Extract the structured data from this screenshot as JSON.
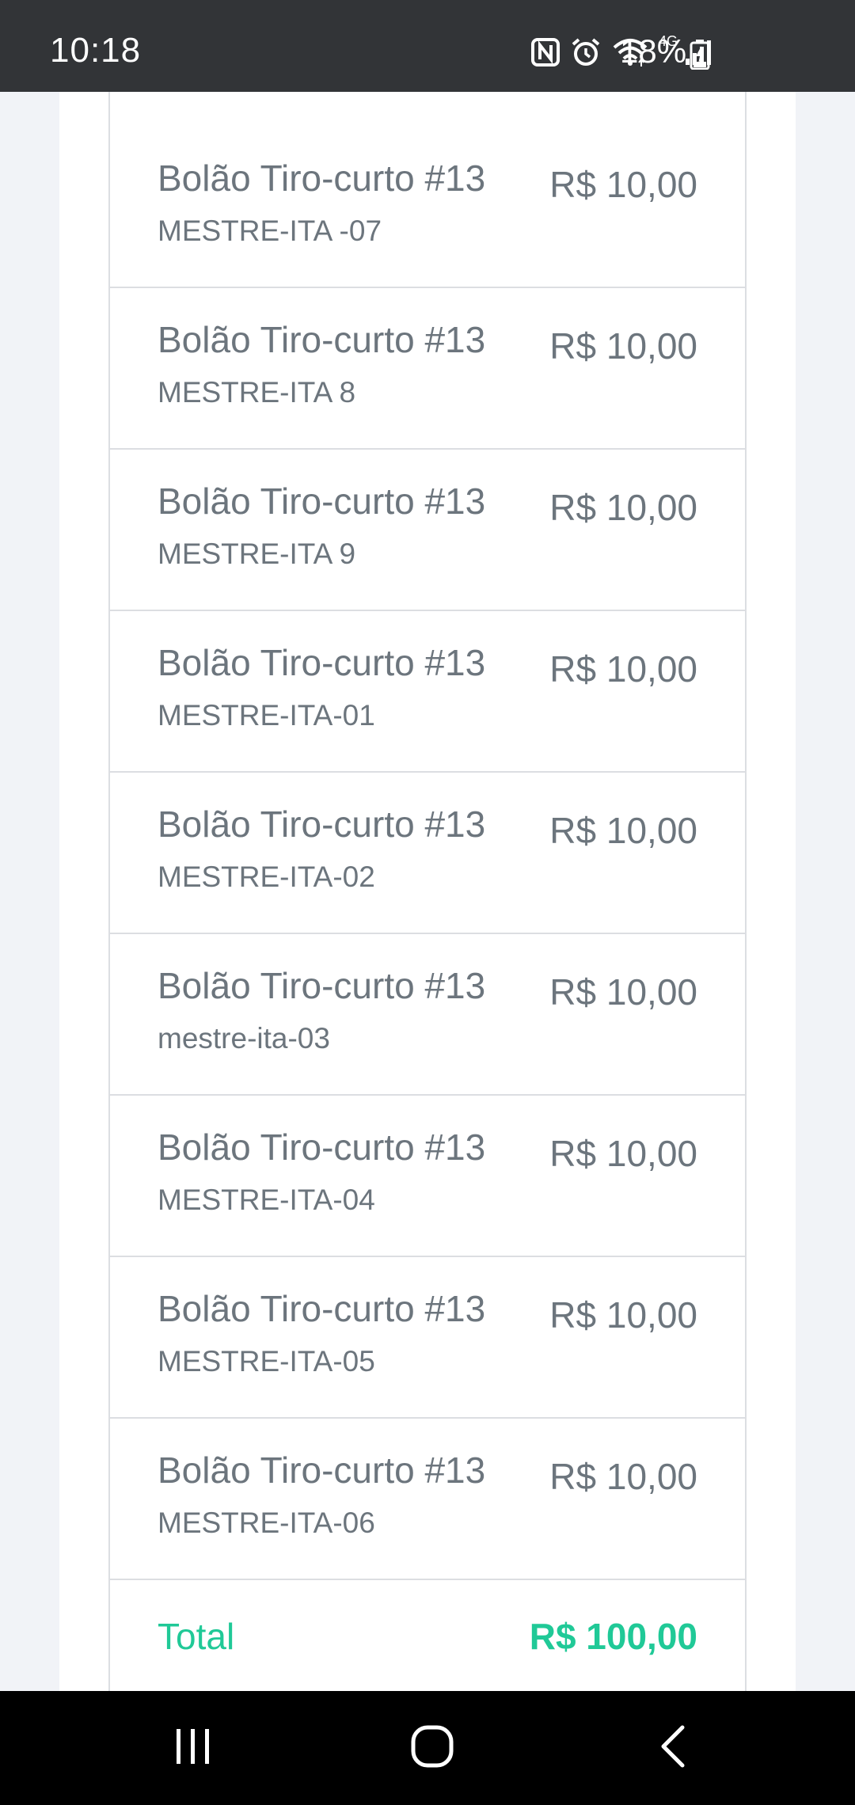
{
  "status_bar": {
    "time": "10:18",
    "network_type": "4G",
    "battery_percent": "18%",
    "icons": [
      "nfc-icon",
      "alarm-icon",
      "wifi-icon",
      "signal-icon",
      "battery-charging-icon"
    ]
  },
  "cart": {
    "items": [
      {
        "title": "Bolão Tiro-curto #13",
        "subtitle": "MESTRE-ITA -07",
        "price": "R$ 10,00"
      },
      {
        "title": "Bolão Tiro-curto #13",
        "subtitle": "MESTRE-ITA 8",
        "price": "R$ 10,00"
      },
      {
        "title": "Bolão Tiro-curto #13",
        "subtitle": "MESTRE-ITA 9",
        "price": "R$ 10,00"
      },
      {
        "title": "Bolão Tiro-curto #13",
        "subtitle": "MESTRE-ITA-01",
        "price": "R$ 10,00"
      },
      {
        "title": "Bolão Tiro-curto #13",
        "subtitle": "MESTRE-ITA-02",
        "price": "R$ 10,00"
      },
      {
        "title": "Bolão Tiro-curto #13",
        "subtitle": "mestre-ita-03",
        "price": "R$ 10,00"
      },
      {
        "title": "Bolão Tiro-curto #13",
        "subtitle": "MESTRE-ITA-04",
        "price": "R$ 10,00"
      },
      {
        "title": "Bolão Tiro-curto #13",
        "subtitle": "MESTRE-ITA-05",
        "price": "R$ 10,00"
      },
      {
        "title": "Bolão Tiro-curto #13",
        "subtitle": "MESTRE-ITA-06",
        "price": "R$ 10,00"
      }
    ],
    "total_label": "Total",
    "total_value": "R$ 100,00"
  },
  "nav_bar": {
    "buttons": [
      "recents-icon",
      "home-icon",
      "back-icon"
    ]
  },
  "colors": {
    "status_bar_bg": "#323437",
    "text_muted": "#6c757d",
    "total_accent": "#20c997",
    "border": "#dcdee2",
    "page_bg": "#f1f3f7"
  }
}
